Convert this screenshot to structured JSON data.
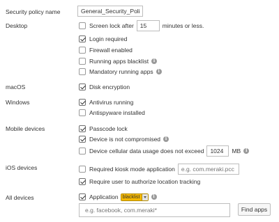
{
  "policy_name": {
    "label": "Security policy name",
    "value": "General_Security_Policy"
  },
  "desktop": {
    "label": "Desktop",
    "screen_lock_prefix": "Screen lock after",
    "screen_lock_value": "15",
    "screen_lock_suffix": "minutes or less.",
    "login_required": "Login required",
    "firewall_enabled": "Firewall enabled",
    "running_apps_blacklist": "Running apps blacklist",
    "mandatory_running_apps": "Mandatory running apps"
  },
  "macos": {
    "label": "macOS",
    "disk_encryption": "Disk encryption"
  },
  "windows": {
    "label": "Windows",
    "antivirus_running": "Antivirus running",
    "antispyware_installed": "Antispyware installed"
  },
  "mobile": {
    "label": "Mobile devices",
    "passcode_lock": "Passcode lock",
    "not_compromised": "Device is not compromised",
    "cellular_usage_prefix": "Device cellular data usage does not exceed",
    "cellular_usage_value": "1024",
    "cellular_usage_unit": "MB"
  },
  "ios": {
    "label": "iOS devices",
    "kiosk_mode": "Required kiosk mode application",
    "kiosk_placeholder": "e.g. com.meraki.pcc",
    "location_tracking": "Require user to authorize location tracking"
  },
  "all_devices": {
    "label": "All devices",
    "application": "Application",
    "list_mode": "blacklist",
    "apps_placeholder": "e.g. facebook, com.meraki*",
    "find_apps_button": "Find apps"
  },
  "checkbox_states": {
    "screen_lock": false,
    "login_required": true,
    "firewall_enabled": false,
    "running_apps_blacklist": false,
    "mandatory_running_apps": false,
    "disk_encryption": true,
    "antivirus_running": true,
    "antispyware_installed": false,
    "passcode_lock": true,
    "not_compromised": true,
    "cellular_usage": false,
    "kiosk_mode": false,
    "location_tracking": true,
    "application": true
  },
  "colors": {
    "accent_badge": "#f5b800",
    "info_icon": "#9a9a9a",
    "text": "#333333"
  },
  "icons": {
    "info": "info-icon",
    "dropdown": "chevron-down-icon"
  }
}
